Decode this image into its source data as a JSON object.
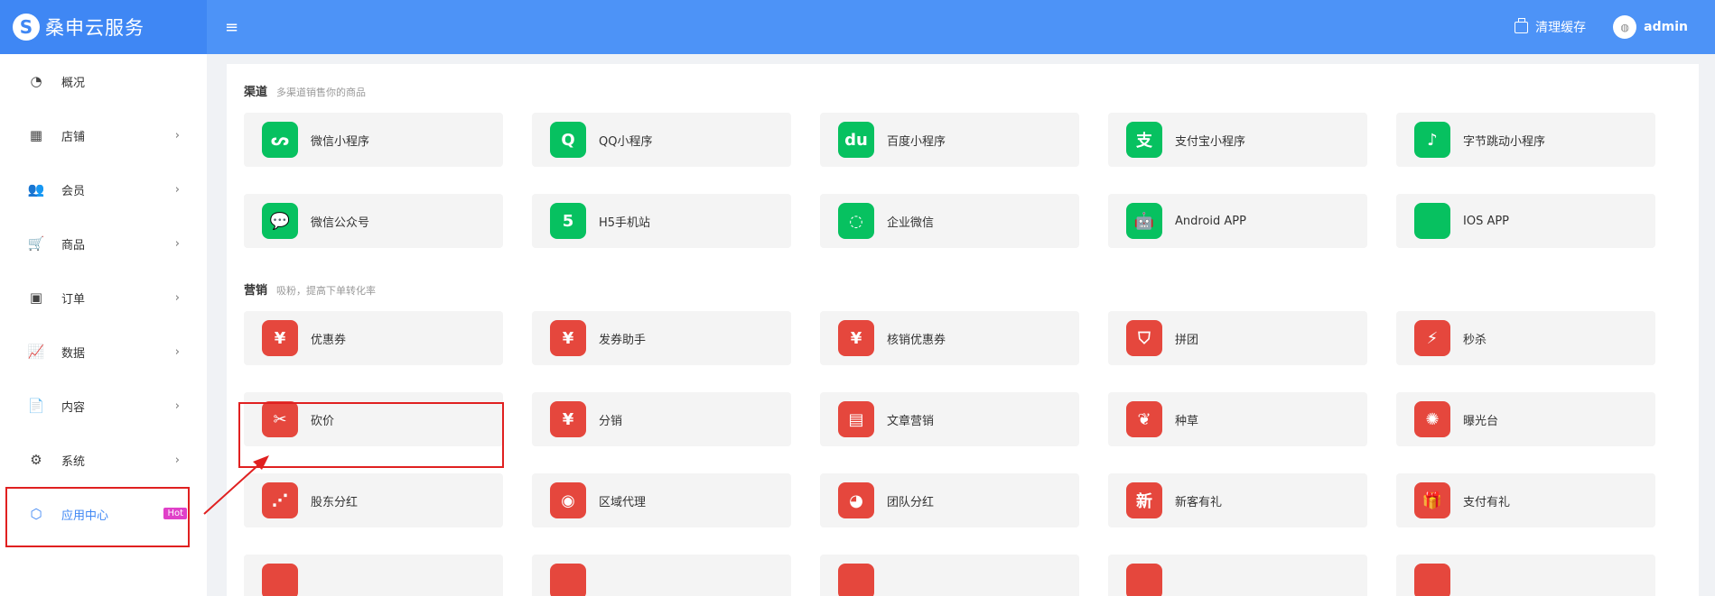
{
  "brand": {
    "logo_letter": "S",
    "name": "桑申云服务"
  },
  "header": {
    "menu_icon": "≡",
    "clear_cache_label": "清理缓存",
    "user_name": "admin"
  },
  "sidebar": {
    "items": [
      {
        "icon": "tachometer-icon",
        "glyph": "◔",
        "label": "概况",
        "chevron": ""
      },
      {
        "icon": "grid-icon",
        "glyph": "▦",
        "label": "店铺",
        "chevron": "›"
      },
      {
        "icon": "users-icon",
        "glyph": "👥",
        "label": "会员",
        "chevron": "›"
      },
      {
        "icon": "cart-icon",
        "glyph": "🛒",
        "label": "商品",
        "chevron": "›"
      },
      {
        "icon": "money-icon",
        "glyph": "▣",
        "label": "订单",
        "chevron": "›"
      },
      {
        "icon": "chart-icon",
        "glyph": "📈",
        "label": "数据",
        "chevron": "›"
      },
      {
        "icon": "document-icon",
        "glyph": "📄",
        "label": "内容",
        "chevron": "›"
      },
      {
        "icon": "gear-icon",
        "glyph": "⚙",
        "label": "系统",
        "chevron": "›"
      },
      {
        "icon": "cube-icon",
        "glyph": "⬡",
        "label": "应用中心",
        "chevron": "",
        "badge": "Hot",
        "active": true
      }
    ]
  },
  "channels": {
    "title": "渠道",
    "desc": "多渠道销售你的商品",
    "items": [
      {
        "label": "微信小程序",
        "glyph": "ᔕ",
        "icon": "mini-program-icon"
      },
      {
        "label": "QQ小程序",
        "glyph": "Q",
        "icon": "qq-icon"
      },
      {
        "label": "百度小程序",
        "glyph": "du",
        "icon": "baidu-icon"
      },
      {
        "label": "支付宝小程序",
        "glyph": "支",
        "icon": "alipay-icon"
      },
      {
        "label": "字节跳动小程序",
        "glyph": "♪",
        "icon": "douyin-icon"
      },
      {
        "label": "微信公众号",
        "glyph": "💬",
        "icon": "wechat-icon"
      },
      {
        "label": "H5手机站",
        "glyph": "5",
        "icon": "html5-icon"
      },
      {
        "label": "企业微信",
        "glyph": "◌",
        "icon": "work-wechat-icon"
      },
      {
        "label": "Android APP",
        "glyph": "🤖",
        "icon": "android-icon"
      },
      {
        "label": "IOS APP",
        "glyph": "",
        "icon": "apple-icon"
      }
    ]
  },
  "marketing": {
    "title": "营销",
    "desc": "吸粉，提高下单转化率",
    "items": [
      {
        "label": "优惠券",
        "glyph": "¥",
        "icon": "coupon-icon"
      },
      {
        "label": "发券助手",
        "glyph": "¥",
        "icon": "coupon-assistant-icon"
      },
      {
        "label": "核销优惠券",
        "glyph": "¥",
        "icon": "verify-coupon-icon"
      },
      {
        "label": "拼团",
        "glyph": "⛉",
        "icon": "group-buy-icon"
      },
      {
        "label": "秒杀",
        "glyph": "⚡",
        "icon": "flash-sale-icon"
      },
      {
        "label": "砍价",
        "glyph": "✂",
        "icon": "bargain-icon"
      },
      {
        "label": "分销",
        "glyph": "¥",
        "icon": "distribution-icon"
      },
      {
        "label": "文章营销",
        "glyph": "▤",
        "icon": "article-icon"
      },
      {
        "label": "种草",
        "glyph": "❦",
        "icon": "seeding-icon"
      },
      {
        "label": "曝光台",
        "glyph": "✺",
        "icon": "exposure-icon"
      },
      {
        "label": "股东分红",
        "glyph": "⋰",
        "icon": "dividend-icon"
      },
      {
        "label": "区域代理",
        "glyph": "◉",
        "icon": "region-agent-icon"
      },
      {
        "label": "团队分红",
        "glyph": "◕",
        "icon": "team-dividend-icon"
      },
      {
        "label": "新客有礼",
        "glyph": "新",
        "icon": "new-customer-icon"
      },
      {
        "label": "支付有礼",
        "glyph": "🎁",
        "icon": "gift-icon"
      },
      {
        "label": "",
        "glyph": "",
        "icon": "app-icon"
      },
      {
        "label": "",
        "glyph": "",
        "icon": "app-icon"
      },
      {
        "label": "",
        "glyph": "",
        "icon": "app-icon"
      },
      {
        "label": "",
        "glyph": "",
        "icon": "app-icon"
      },
      {
        "label": "",
        "glyph": "",
        "icon": "app-icon"
      }
    ]
  },
  "colors": {
    "primary": "#4d93f7",
    "channel_icon": "#07c160",
    "marketing_icon": "#e5473d",
    "annotation": "#e02020"
  }
}
